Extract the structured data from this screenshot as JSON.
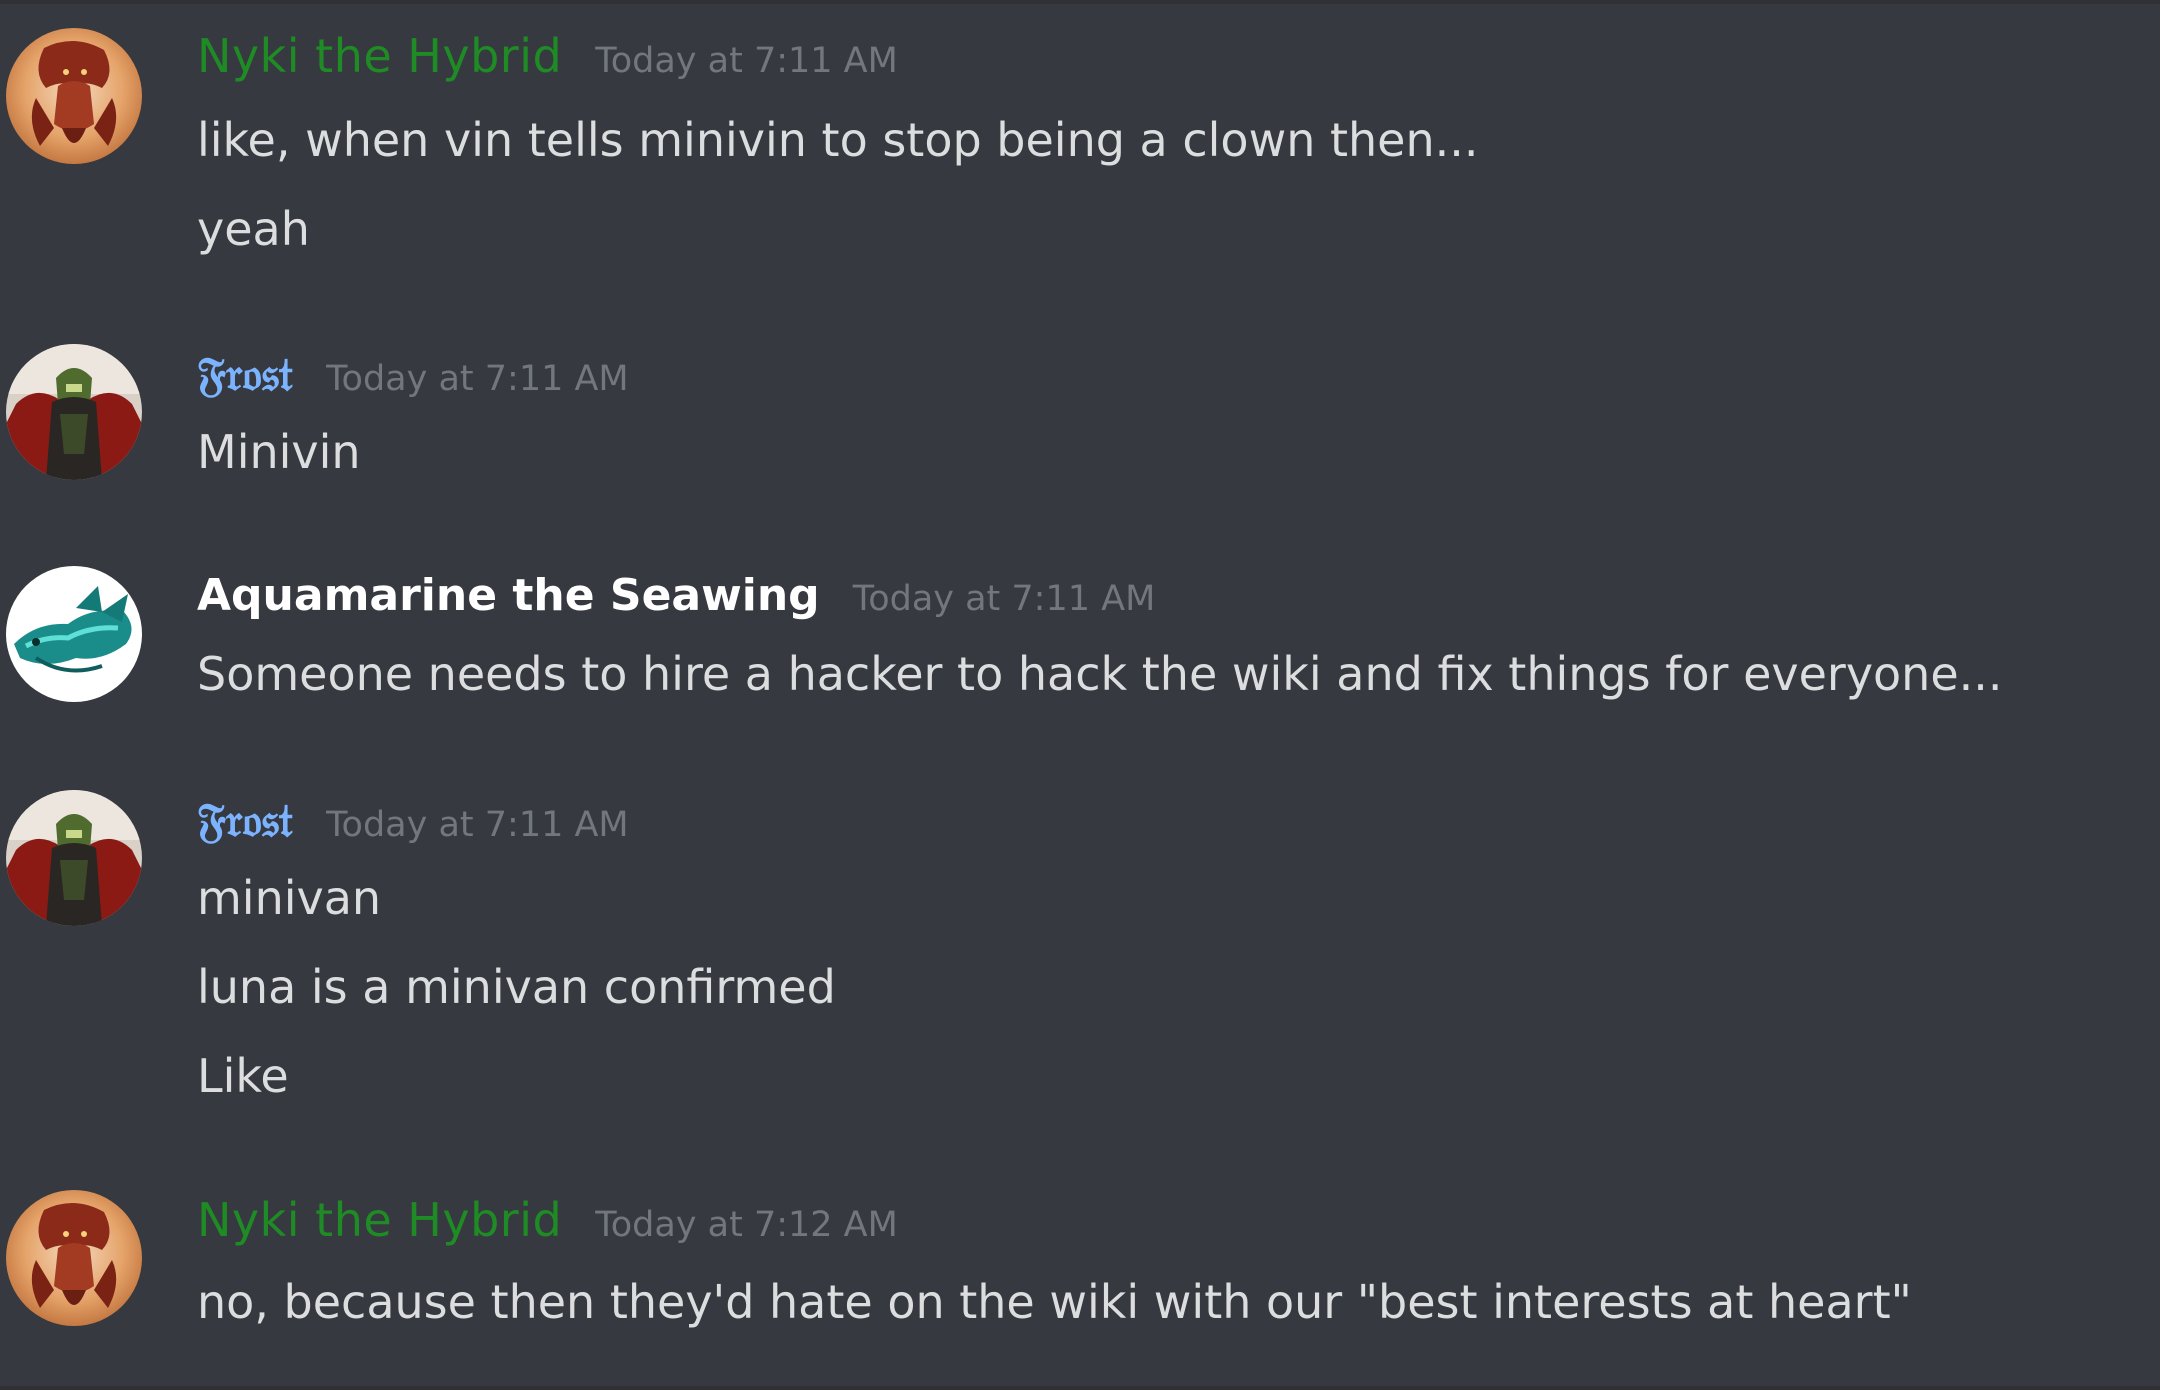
{
  "groups": [
    {
      "author": "Nyki the Hybrid",
      "timestamp": "Today at 7:11 AM",
      "messages": [
        "like, when vin tells minivin to stop being a clown then...",
        "yeah"
      ]
    },
    {
      "author": "𝔉𝔯𝔬𝔰𝔱",
      "timestamp": "Today at 7:11 AM",
      "messages": [
        "Minivin"
      ]
    },
    {
      "author": "Aquamarine the Seawing",
      "timestamp": "Today at 7:11 AM",
      "messages": [
        "Someone needs to hire a hacker to hack the wiki and fix things for everyone..."
      ]
    },
    {
      "author": "𝔉𝔯𝔬𝔰𝔱",
      "timestamp": "Today at 7:11 AM",
      "messages": [
        "minivan",
        "luna is a minivan confirmed",
        "Like"
      ]
    },
    {
      "author": "Nyki the Hybrid",
      "timestamp": "Today at 7:12 AM",
      "messages": [
        "no, because then they'd hate on the wiki with our \"best interests at heart\""
      ]
    }
  ],
  "colors": {
    "background": "#36393f",
    "nyki_name": "#1f8b24",
    "frost_name": "#7cb3ff",
    "aquamarine_name": "#ffffff",
    "timestamp": "#72767d",
    "message_text": "#dcddde"
  },
  "icons": {
    "nyki_avatar": "red-dragon-avatar-icon",
    "frost_avatar": "dark-knight-avatar-icon",
    "aquamarine_avatar": "teal-seawing-dragon-avatar-icon"
  }
}
